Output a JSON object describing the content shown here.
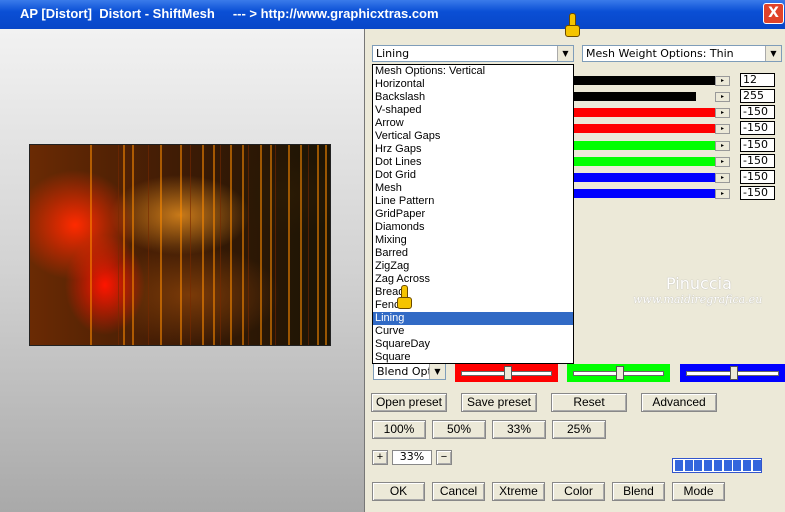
{
  "window": {
    "title": "AP [Distort]  Distort - ShiftMesh     --- > http://www.graphicxtras.com",
    "close_label": "X"
  },
  "top_combo": {
    "value": "Lining"
  },
  "weight_combo": {
    "value": "Mesh Weight Options: Thin"
  },
  "dropdown": {
    "options": [
      "Mesh Options: Vertical",
      "Horizontal",
      "Backslash",
      "V-shaped",
      "Arrow",
      "Vertical Gaps",
      "Hrz Gaps",
      "Dot Lines",
      "Dot Grid",
      "Mesh",
      "Line Pattern",
      "GridPaper",
      "Diamonds",
      "Mixing",
      "Barred",
      "ZigZag",
      "Zag Across",
      "Bread",
      "Fence",
      "Lining",
      "Curve",
      "SquareDay",
      "Square"
    ],
    "selected": "Lining"
  },
  "sliders": [
    {
      "color": "#000000",
      "fill": 1.0,
      "value": "12"
    },
    {
      "color": "#000000",
      "fill": 0.86,
      "value": "255"
    },
    {
      "color": "#ff0000",
      "fill": 1.0,
      "value": "-150"
    },
    {
      "color": "#ff0000",
      "fill": 1.0,
      "value": "-150"
    },
    {
      "color": "#00ff00",
      "fill": 1.0,
      "value": "-150"
    },
    {
      "color": "#00ff00",
      "fill": 1.0,
      "value": "-150"
    },
    {
      "color": "#0000ff",
      "fill": 1.0,
      "value": "-150"
    },
    {
      "color": "#0000ff",
      "fill": 1.0,
      "value": "-150"
    }
  ],
  "watermark": {
    "line1": "Pinuccia",
    "line2": "www.maidiregrafica.eu"
  },
  "blend_combo": {
    "value": "Blend Optio"
  },
  "color_sliders": [
    {
      "color": "#ff0000",
      "level": 0.5
    },
    {
      "color": "#00ff00",
      "level": 0.5
    },
    {
      "color": "#0000ff",
      "level": 0.5
    }
  ],
  "buttons": {
    "open_preset": "Open preset",
    "save_preset": "Save preset",
    "reset": "Reset",
    "advanced": "Advanced",
    "z100": "100%",
    "z50": "50%",
    "z33": "33%",
    "z25": "25%",
    "zoom_plus": "+",
    "zoom_minus": "−",
    "ok": "OK",
    "cancel": "Cancel",
    "xtreme": "Xtreme",
    "color": "Color",
    "blend": "Blend",
    "mode": "Mode"
  },
  "zoom": {
    "value": "33%"
  },
  "progress": {
    "cells": 9
  },
  "icons": {
    "pointer": "hand-pointer-icon",
    "arrow": "chevron-down-icon"
  }
}
